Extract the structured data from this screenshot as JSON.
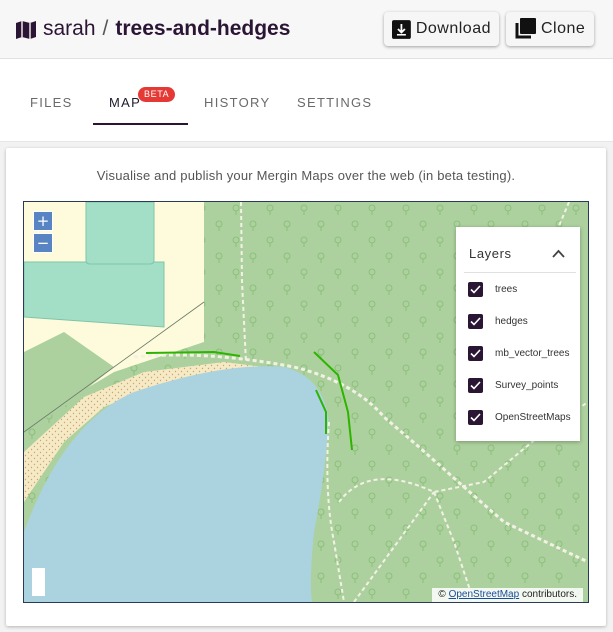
{
  "header": {
    "owner": "sarah",
    "separator": "/",
    "project": "trees-and-hedges",
    "project_icon": "map-icon",
    "download_label": "Download",
    "download_icon": "download-icon",
    "clone_label": "Clone",
    "clone_icon": "clone-icon"
  },
  "tabs": [
    {
      "label": "FILES",
      "active": false
    },
    {
      "label": "MAP",
      "active": true,
      "badge": "BETA"
    },
    {
      "label": "HISTORY",
      "active": false
    },
    {
      "label": "SETTINGS",
      "active": false
    }
  ],
  "map_section": {
    "intro": "Visualise and publish your Mergin Maps over the web (in beta testing).",
    "zoom_in": "+",
    "zoom_out": "−",
    "layers": {
      "title": "Layers",
      "items": [
        {
          "label": "trees",
          "checked": true
        },
        {
          "label": "hedges",
          "checked": true
        },
        {
          "label": "mb_vector_trees",
          "checked": true
        },
        {
          "label": "Survey_points",
          "checked": true
        },
        {
          "label": "OpenStreetMaps",
          "checked": true
        }
      ]
    },
    "attribution": {
      "prefix": "©",
      "link": "OpenStreetMap",
      "suffix": "contributors."
    }
  },
  "colors": {
    "accent": "#2b1535",
    "badge": "#e53935",
    "hedge_line": "#2db400",
    "water": "#aad3df",
    "woodland": "#add19e",
    "sand": "#f5e9c6",
    "grass": "#a3dfc7"
  }
}
